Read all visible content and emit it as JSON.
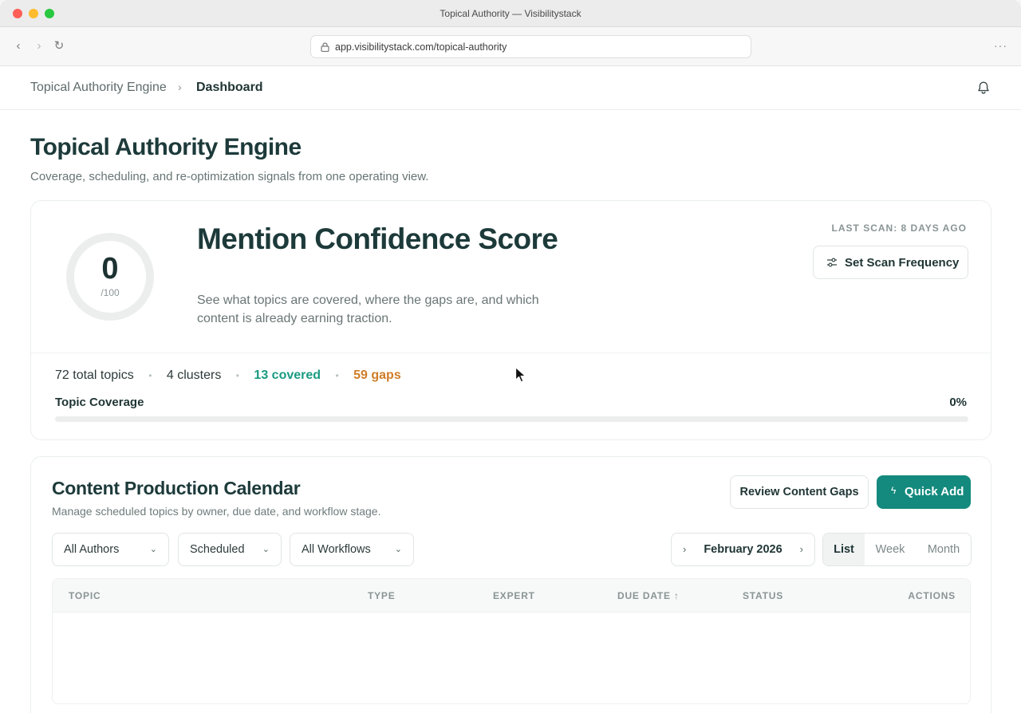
{
  "window": {
    "title": "Topical Authority — Visibilitystack"
  },
  "browser": {
    "url": "app.visibilitystack.com/topical-authority",
    "back_icon": "‹",
    "forward_icon": "›",
    "reload_icon": "↻",
    "more_icon": "···"
  },
  "header": {
    "breadcrumb_root": "Topical Authority Engine",
    "breadcrumb_sep": "›",
    "breadcrumb_current": "Dashboard"
  },
  "page": {
    "title": "Topical Authority Engine",
    "subtitle": "Coverage, scheduling, and re-optimization signals from one operating view."
  },
  "score": {
    "value": "0",
    "max": "/100",
    "title": "Mention Confidence Score",
    "description": "See what topics are covered, where the gaps are, and which content is already earning traction.",
    "last_scan": "LAST SCAN: 8 DAYS AGO",
    "scan_button": "Set Scan Frequency",
    "stats": {
      "total": "72 total topics",
      "clusters": "4 clusters",
      "covered": "13 covered",
      "gaps": "59 gaps",
      "separator": "•"
    },
    "coverage_label": "Topic Coverage",
    "coverage_pct": "0%",
    "coverage_fraction": 0,
    "accent_color": "#1a9a82",
    "gap_color": "#d07d29"
  },
  "calendar": {
    "title": "Content Production Calendar",
    "subtitle": "Manage scheduled topics by owner, due date, and workflow stage.",
    "review_button": "Review Content Gaps",
    "quick_add_button": "Quick Add",
    "quick_add_icon": "ϟ",
    "filters": {
      "authors": "All Authors",
      "status": "Scheduled",
      "workflow": "All Workflows",
      "chevron": "⌄"
    },
    "month": {
      "label": "February 2026",
      "prev": "›",
      "next": "›"
    },
    "views": [
      "List",
      "Week",
      "Month"
    ],
    "columns": [
      "TOPIC",
      "TYPE",
      "EXPERT",
      "DUE DATE ↑",
      "STATUS",
      "ACTIONS"
    ],
    "rows": [],
    "brand_color": "#138a7d"
  }
}
